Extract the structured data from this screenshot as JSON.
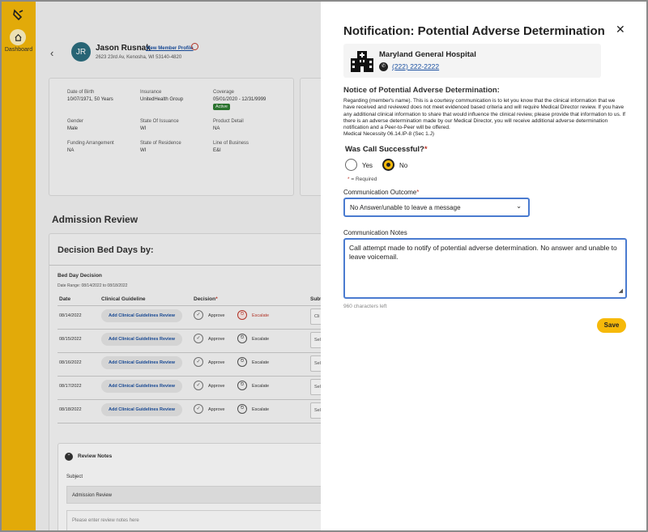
{
  "rail": {
    "dashboard_label": "Dashboard"
  },
  "member": {
    "initials": "JR",
    "name": "Jason Rusnak",
    "view_profile": "View Member Profile",
    "address": "2623 23rd Av, Kenosha, WI 53140-4820"
  },
  "info": {
    "dob_label": "Date of Birth",
    "dob": "10/07/1971, 50 Years",
    "insurance_label": "Insurance",
    "insurance": "UnitedHealth Group",
    "coverage_label": "Coverage",
    "coverage": "05/01/2020 - 12/31/9999",
    "coverage_status": "Active",
    "gender_label": "Gender",
    "gender": "Male",
    "state_issuance_label": "State Of Issuance",
    "state_issuance": "WI",
    "product_label": "Product Detail",
    "product": "NA",
    "funding_label": "Funding Arrangement",
    "funding": "NA",
    "state_residence_label": "State of Residence",
    "state_residence": "WI",
    "lob_label": "Line of Business",
    "lob": "E&I"
  },
  "admission": {
    "title": "Admission Review",
    "decision_title": "Decision Bed Days by:",
    "bed_day": "Bed Day Decision",
    "date_range": "Date Range: 08/14/2022 to 08/18/2022",
    "headers": {
      "date": "Date",
      "guideline": "Clinical Guideline",
      "decision": "Decision",
      "sub": "Subt"
    },
    "rows": [
      {
        "date": "08/14/2022",
        "guideline": "Add Clinical Guidelines Review",
        "approve": "Approve",
        "escalate": "Escalate",
        "sub": "Cli"
      },
      {
        "date": "08/15/2022",
        "guideline": "Add Clinical Guidelines Review",
        "approve": "Approve",
        "escalate": "Escalate",
        "sub": "Sele"
      },
      {
        "date": "08/16/2022",
        "guideline": "Add Clinical Guidelines Review",
        "approve": "Approve",
        "escalate": "Escalate",
        "sub": "Sele"
      },
      {
        "date": "08/17/2022",
        "guideline": "Add Clinical Guidelines Review",
        "approve": "Approve",
        "escalate": "Escalate",
        "sub": "Sele"
      },
      {
        "date": "08/18/2022",
        "guideline": "Add Clinical Guidelines Review",
        "approve": "Approve",
        "escalate": "Escalate",
        "sub": "Sele"
      }
    ],
    "review_notes": "Review Notes",
    "subject_label": "Subject",
    "subject_value": "Admission Review",
    "notes_placeholder": "Please enter review notes here"
  },
  "modal": {
    "title": "Notification: Potential Adverse Determination",
    "hospital_name": "Maryland General Hospital",
    "phone": "(222) 222-2222",
    "notice_title": "Notice of Potential Adverse Determination:",
    "notice_body": "Regarding (member's name).  This is a courtesy communication is to let you know that the clinical information that we have received and reviewed does not meet evidenced based criteria and will require Medical Director review. If you have any additional clinical information to share that would influence the clinical review, please provide that information to us.  If there is an adverse determination made by our Medical Director, you will receive additional adverse determination notification and a Peer-to-Peer will be offered.",
    "notice_ref": "Medical Necessity 06.14.IP-8 (Sec 1.J)",
    "call_question": "Was Call Successful?",
    "yes": "Yes",
    "no": "No",
    "required_note": "= Required",
    "outcome_label": "Communication Outcome",
    "outcome_value": "No Answer/unable to leave a message",
    "notes_label": "Communication Notes",
    "notes_value": "Call attempt made to notify of potential adverse determination. No answer and unable to leave voicemail.",
    "chars_left": "960 characters left",
    "save": "Save"
  },
  "colors": {
    "accent": "#f6b90a",
    "link": "#1a4fa0",
    "focus": "#4a7bd0",
    "required": "#c0392b"
  }
}
